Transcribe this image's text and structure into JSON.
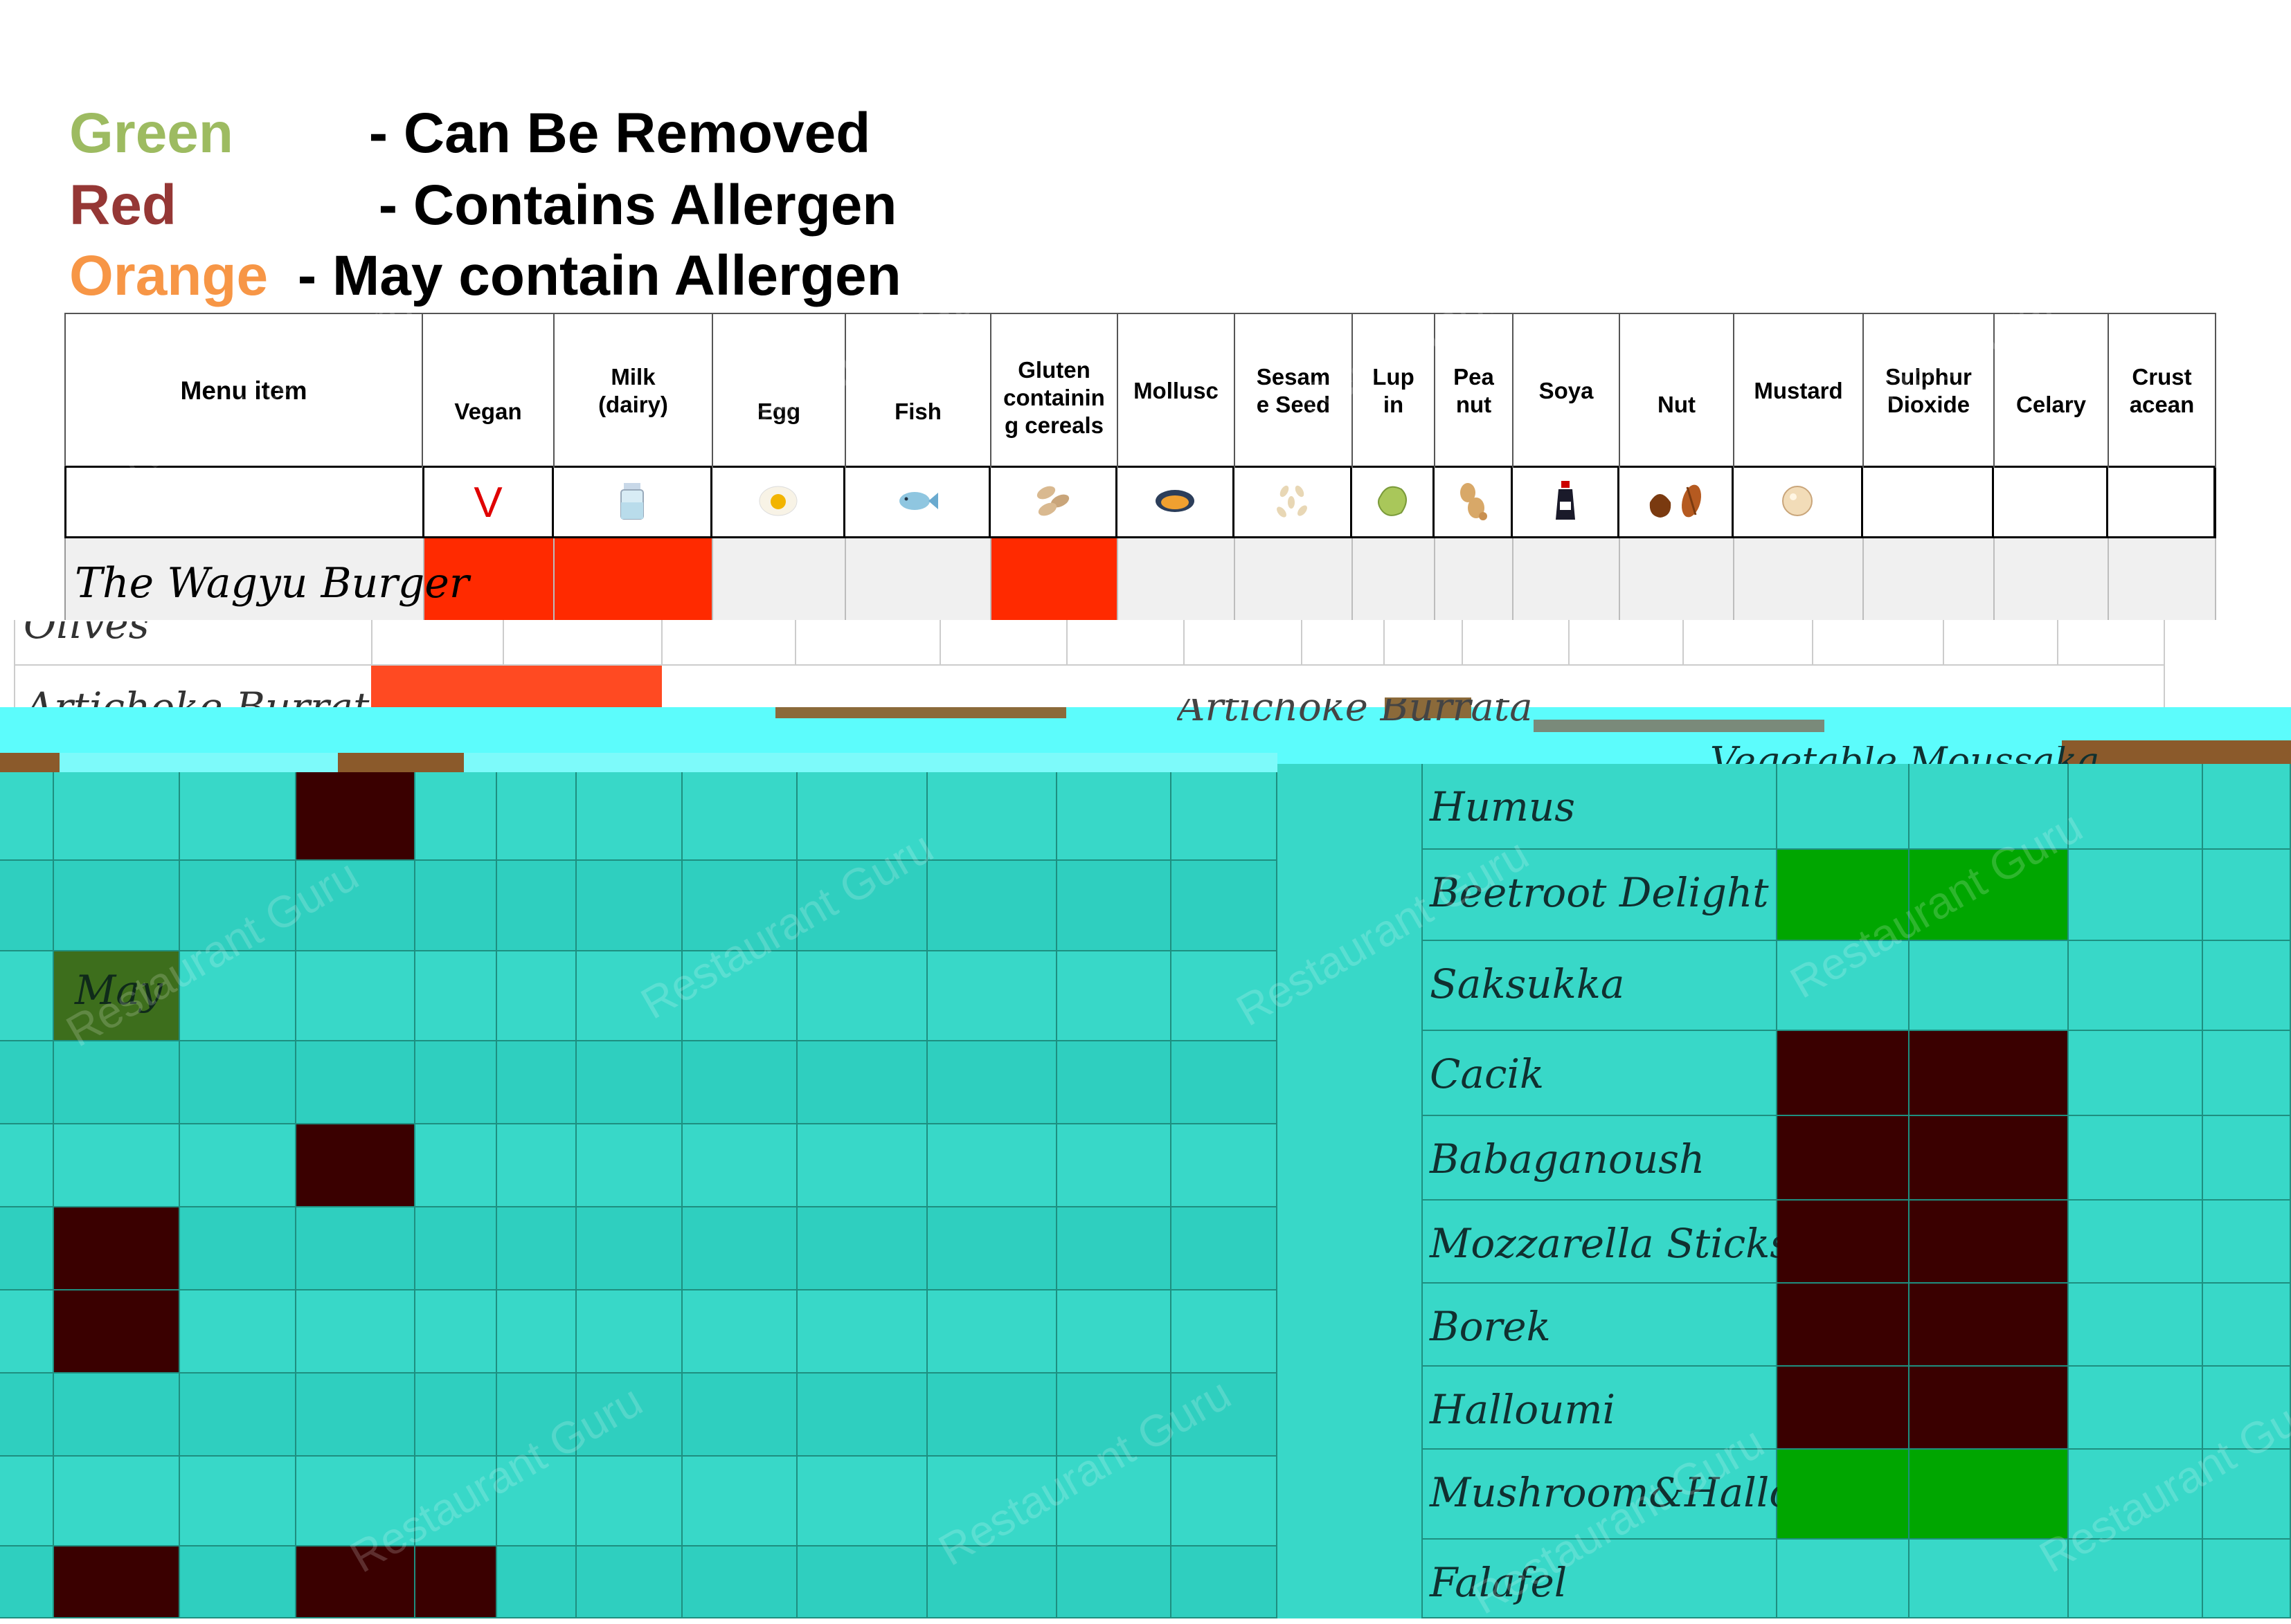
{
  "legend": [
    {
      "word": "Green",
      "desc": "- Can Be Removed",
      "color": "#9dbb61"
    },
    {
      "word": "Red",
      "desc": "- Contains Allergen",
      "color": "#953735"
    },
    {
      "word": "Orange",
      "desc": "- May contain Allergen",
      "color": "#f79646"
    }
  ],
  "header": {
    "menu_item": "Menu item",
    "columns": [
      {
        "label": "Vegan",
        "icon": "vegan-v-icon"
      },
      {
        "label": "Milk\n(dairy)",
        "icon": "milk-bottle-icon"
      },
      {
        "label": "Egg",
        "icon": "egg-icon"
      },
      {
        "label": "Fish",
        "icon": "fish-icon"
      },
      {
        "label": "Gluten\ncontainin\ng cereals",
        "icon": "grain-icon"
      },
      {
        "label": "Mollusc",
        "icon": "mussel-icon"
      },
      {
        "label": "Sesam\ne Seed",
        "icon": "sesame-icon"
      },
      {
        "label": "Lup\nin",
        "icon": "lupin-bean-icon"
      },
      {
        "label": "Pea\nnut",
        "icon": "peanut-icon"
      },
      {
        "label": "Soya",
        "icon": "soy-sauce-icon"
      },
      {
        "label": "Nut",
        "icon": "nuts-icon"
      },
      {
        "label": "Mustard",
        "icon": "mustard-seed-icon"
      },
      {
        "label": "Sulphur\nDioxide",
        "icon": ""
      },
      {
        "label": "Celary",
        "icon": ""
      },
      {
        "label": "Crust\nacean",
        "icon": ""
      }
    ],
    "vegan_symbol": "V"
  },
  "top_rows": [
    {
      "name": "The Wagyu Burger"
    },
    {
      "name": "Olives"
    },
    {
      "name": "Artichoke Burrata"
    }
  ],
  "fragment_text": "Artichoke Burrata",
  "fragment_text_2": "Vegetable Moussaka",
  "may_label": "May",
  "right_dishes": [
    "Humus",
    "Beetroot Delight",
    "Saksukka",
    "Cacik",
    "Babaganoush",
    "Mozzarella Sticks",
    "Borek",
    "Halloumi",
    "Mushroom&Halloumi",
    "Falafel"
  ],
  "watermark": "Restaurant Guru",
  "colors": {
    "red": "#ff2a00",
    "teal": "#38d8c8",
    "teal_dark": "#2bc7b7",
    "dark_maroon": "#3a0000",
    "green": "#00a600",
    "olive": "#3d6e1c",
    "cyan_bar": "#5cfcfc",
    "brown": "#8b5a2b"
  }
}
